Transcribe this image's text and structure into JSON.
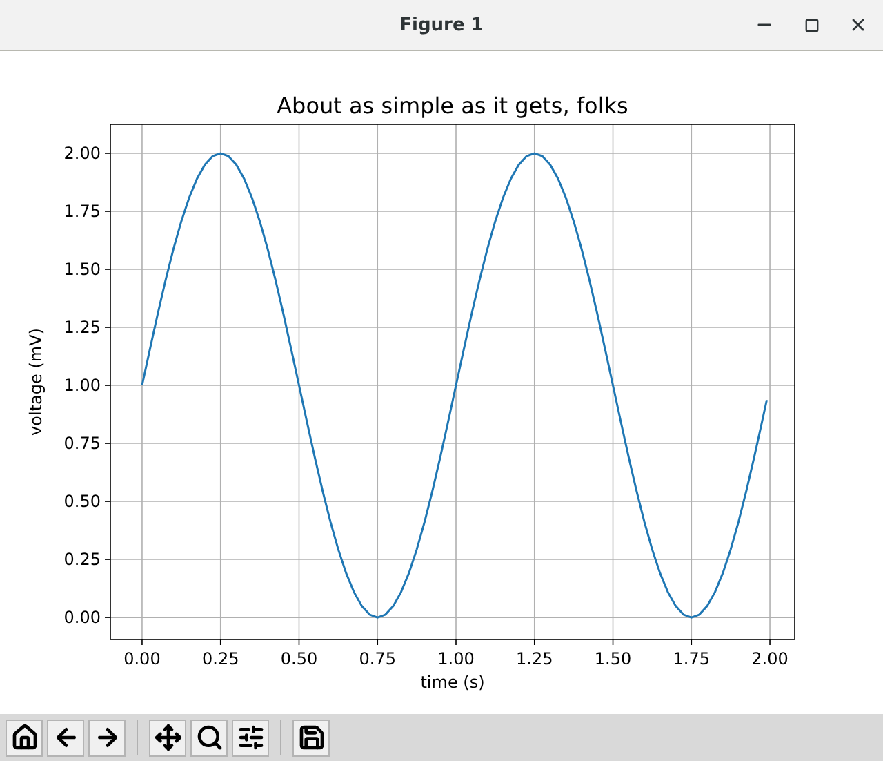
{
  "window": {
    "title": "Figure 1",
    "controls": [
      {
        "kind": "minimize"
      },
      {
        "kind": "maximize"
      },
      {
        "kind": "close"
      }
    ]
  },
  "figure": {
    "chart_data": {
      "type": "line",
      "title": "About as simple as it gets, folks",
      "xlabel": "time (s)",
      "ylabel": "voltage (mV)",
      "x": [
        0,
        0.025,
        0.05,
        0.075,
        0.1,
        0.125,
        0.15,
        0.175,
        0.2,
        0.225,
        0.25,
        0.275,
        0.3,
        0.325,
        0.35,
        0.375,
        0.4,
        0.425,
        0.45,
        0.475,
        0.5,
        0.525,
        0.55,
        0.575,
        0.6,
        0.625,
        0.65,
        0.675,
        0.7,
        0.725,
        0.75,
        0.775,
        0.8,
        0.825,
        0.85,
        0.875,
        0.9,
        0.925,
        0.95,
        0.975,
        1,
        1.025,
        1.05,
        1.075,
        1.1,
        1.125,
        1.15,
        1.175,
        1.2,
        1.225,
        1.25,
        1.275,
        1.3,
        1.325,
        1.35,
        1.375,
        1.4,
        1.425,
        1.45,
        1.475,
        1.5,
        1.525,
        1.55,
        1.575,
        1.6,
        1.625,
        1.65,
        1.675,
        1.7,
        1.725,
        1.75,
        1.775,
        1.8,
        1.825,
        1.85,
        1.875,
        1.9,
        1.925,
        1.95,
        1.975,
        1.99
      ],
      "series": [
        {
          "color": "#1f77b4",
          "values": [
            1,
            1.156,
            1.309,
            1.454,
            1.588,
            1.707,
            1.809,
            1.891,
            1.951,
            1.988,
            2,
            1.988,
            1.951,
            1.891,
            1.809,
            1.707,
            1.588,
            1.454,
            1.309,
            1.156,
            1,
            0.844,
            0.691,
            0.546,
            0.412,
            0.293,
            0.191,
            0.109,
            0.049,
            0.012,
            0,
            0.012,
            0.049,
            0.109,
            0.191,
            0.293,
            0.412,
            0.546,
            0.691,
            0.844,
            1,
            1.156,
            1.309,
            1.454,
            1.588,
            1.707,
            1.809,
            1.891,
            1.951,
            1.988,
            2,
            1.988,
            1.951,
            1.891,
            1.809,
            1.707,
            1.588,
            1.454,
            1.309,
            1.156,
            1,
            0.844,
            0.691,
            0.546,
            0.412,
            0.293,
            0.191,
            0.109,
            0.049,
            0.012,
            0,
            0.012,
            0.049,
            0.109,
            0.191,
            0.293,
            0.412,
            0.546,
            0.691,
            0.844,
            0.937
          ]
        }
      ],
      "xlim": [
        -0.101,
        2.079
      ],
      "ylim": [
        -0.095,
        2.125
      ],
      "xticks": [
        {
          "value": 0,
          "label": "0.00"
        },
        {
          "value": 0.25,
          "label": "0.25"
        },
        {
          "value": 0.5,
          "label": "0.50"
        },
        {
          "value": 0.75,
          "label": "0.75"
        },
        {
          "value": 1,
          "label": "1.00"
        },
        {
          "value": 1.25,
          "label": "1.25"
        },
        {
          "value": 1.5,
          "label": "1.50"
        },
        {
          "value": 1.75,
          "label": "1.75"
        },
        {
          "value": 2,
          "label": "2.00"
        }
      ],
      "yticks": [
        {
          "value": 0,
          "label": "0.00"
        },
        {
          "value": 0.25,
          "label": "0.25"
        },
        {
          "value": 0.5,
          "label": "0.50"
        },
        {
          "value": 0.75,
          "label": "0.75"
        },
        {
          "value": 1,
          "label": "1.00"
        },
        {
          "value": 1.25,
          "label": "1.25"
        },
        {
          "value": 1.5,
          "label": "1.50"
        },
        {
          "value": 1.75,
          "label": "1.75"
        },
        {
          "value": 2,
          "label": "2.00"
        }
      ],
      "grid": true
    }
  },
  "toolbar": {
    "buttons": [
      {
        "kind": "home"
      },
      {
        "kind": "back"
      },
      {
        "kind": "forward"
      },
      {
        "kind": "separator"
      },
      {
        "kind": "pan"
      },
      {
        "kind": "zoom"
      },
      {
        "kind": "configure"
      },
      {
        "kind": "separator"
      },
      {
        "kind": "save"
      }
    ]
  }
}
